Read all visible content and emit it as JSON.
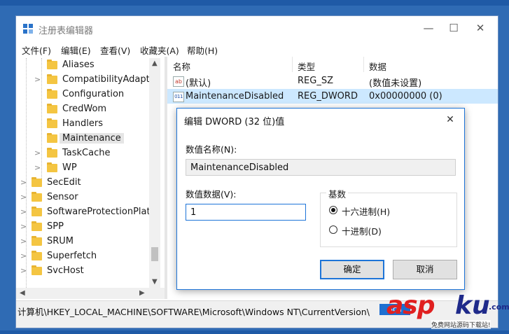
{
  "window": {
    "title": "注册表编辑器",
    "controls": [
      "—",
      "☐",
      "✕"
    ]
  },
  "menu": [
    "文件(F)",
    "编辑(E)",
    "查看(V)",
    "收藏夹(A)",
    "帮助(H)"
  ],
  "tree": {
    "items": [
      {
        "label": "Aliases",
        "expandable": false,
        "level": 1
      },
      {
        "label": "CompatibilityAdapte",
        "expandable": true,
        "level": 1
      },
      {
        "label": "Configuration",
        "expandable": false,
        "level": 1
      },
      {
        "label": "CredWom",
        "expandable": false,
        "level": 1
      },
      {
        "label": "Handlers",
        "expandable": false,
        "level": 1
      },
      {
        "label": "Maintenance",
        "expandable": false,
        "level": 1,
        "selected": true
      },
      {
        "label": "TaskCache",
        "expandable": true,
        "level": 1
      },
      {
        "label": "WP",
        "expandable": true,
        "level": 1
      },
      {
        "label": "SecEdit",
        "expandable": true,
        "level": 0
      },
      {
        "label": "Sensor",
        "expandable": true,
        "level": 0
      },
      {
        "label": "SoftwareProtectionPlatf",
        "expandable": true,
        "level": 0
      },
      {
        "label": "SPP",
        "expandable": true,
        "level": 0
      },
      {
        "label": "SRUM",
        "expandable": true,
        "level": 0
      },
      {
        "label": "Superfetch",
        "expandable": true,
        "level": 0
      },
      {
        "label": "SvcHost",
        "expandable": true,
        "level": 0
      }
    ]
  },
  "list": {
    "columns": [
      "名称",
      "类型",
      "数据"
    ],
    "rows": [
      {
        "icon": "string-value-icon",
        "name": "(默认)",
        "type": "REG_SZ",
        "data": "(数值未设置)"
      },
      {
        "icon": "dword-value-icon",
        "name": "MaintenanceDisabled",
        "type": "REG_DWORD",
        "data": "0x00000000 (0)",
        "selected": true
      }
    ]
  },
  "status": {
    "path": "计算机\\HKEY_LOCAL_MACHINE\\SOFTWARE\\Microsoft\\Windows NT\\CurrentVersion\\",
    "tail": "Sch"
  },
  "dialog": {
    "title": "编辑 DWORD (32 位)值",
    "value_name_label": "数值名称(N):",
    "value_name": "MaintenanceDisabled",
    "value_data_label": "数值数据(V):",
    "value_data": "1",
    "base_label": "基数",
    "base_options": [
      {
        "label": "十六进制(H)",
        "selected": true
      },
      {
        "label": "十进制(D)",
        "selected": false
      }
    ],
    "ok_label": "确定",
    "cancel_label": "取消"
  },
  "watermark": {
    "asp": "asp",
    "ku": "ku",
    "com": ".com",
    "sub": "免费网站源码下载站!"
  },
  "colors": {
    "accent": "#1d74d8",
    "selection": "#cce8ff",
    "folder": "#f4c542"
  }
}
